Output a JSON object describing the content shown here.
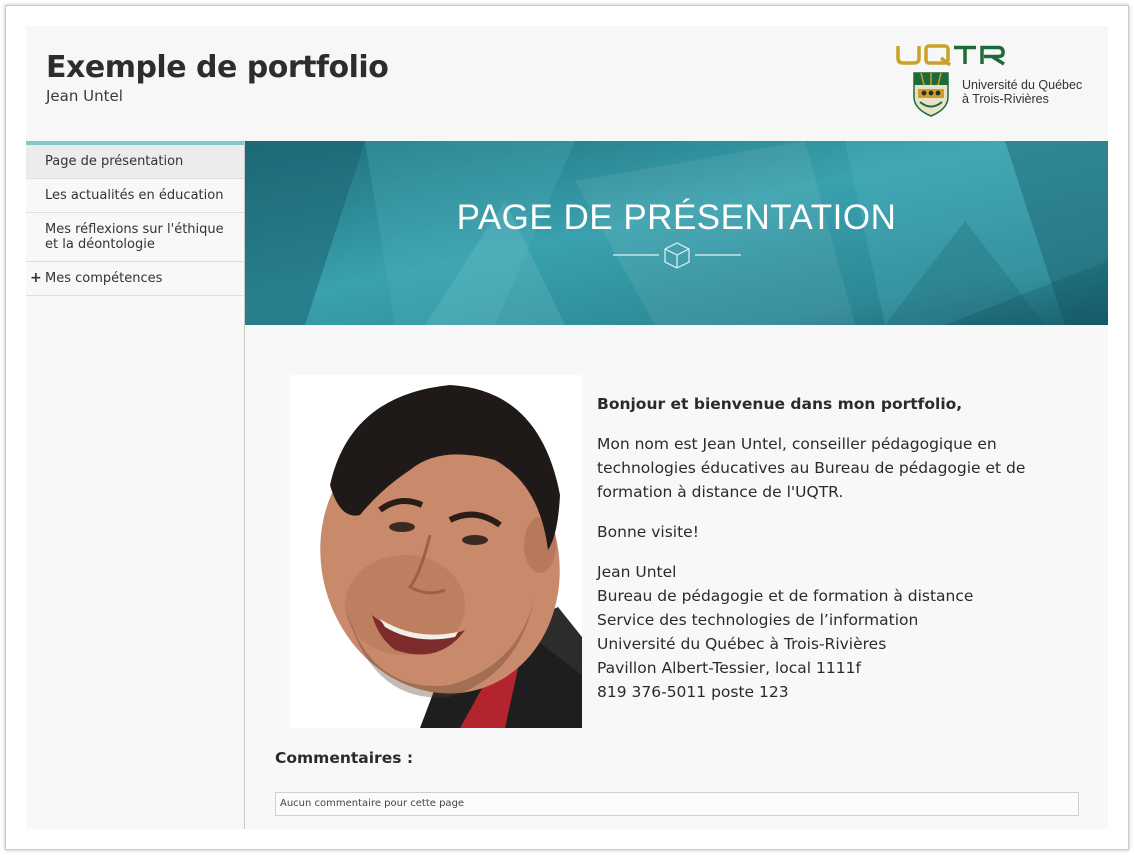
{
  "header": {
    "title": "Exemple de portfolio",
    "subtitle": "Jean Untel",
    "logo": {
      "wordmark": "UQTR",
      "line1": "Université du Québec",
      "line2": "à Trois-Rivières"
    }
  },
  "sidebar": {
    "items": [
      {
        "label": "Page de présentation",
        "active": true
      },
      {
        "label": "Les actualités en éducation"
      },
      {
        "label": "Mes réflexions sur l'éthique et la déontologie"
      },
      {
        "label": "Mes compétences",
        "expandable": true,
        "expand_symbol": "+"
      }
    ]
  },
  "banner": {
    "title": "PAGE DE PRÉSENTATION"
  },
  "content": {
    "greeting": "Bonjour et bienvenue dans mon portfolio,",
    "paragraph": "Mon nom est Jean Untel, conseiller pédagogique en technologies éducatives au Bureau de pédagogie et de formation à distance de l'UQTR.",
    "closing": "Bonne visite!",
    "signature": [
      "Jean Untel",
      "Bureau de pédagogie et de formation à distance",
      "Service des technologies de l’information",
      "Université du Québec à Trois-Rivières",
      "Pavillon Albert-Tessier, local 1111f",
      "819 376-5011 poste 123"
    ]
  },
  "comments": {
    "title": "Commentaires :",
    "empty_text": "Aucun commentaire pour cette page"
  },
  "colors": {
    "banner": "#2f8d9b",
    "accent": "#7ec7d1",
    "uqtr_gold": "#c9a227",
    "uqtr_green": "#1d6b3a"
  }
}
